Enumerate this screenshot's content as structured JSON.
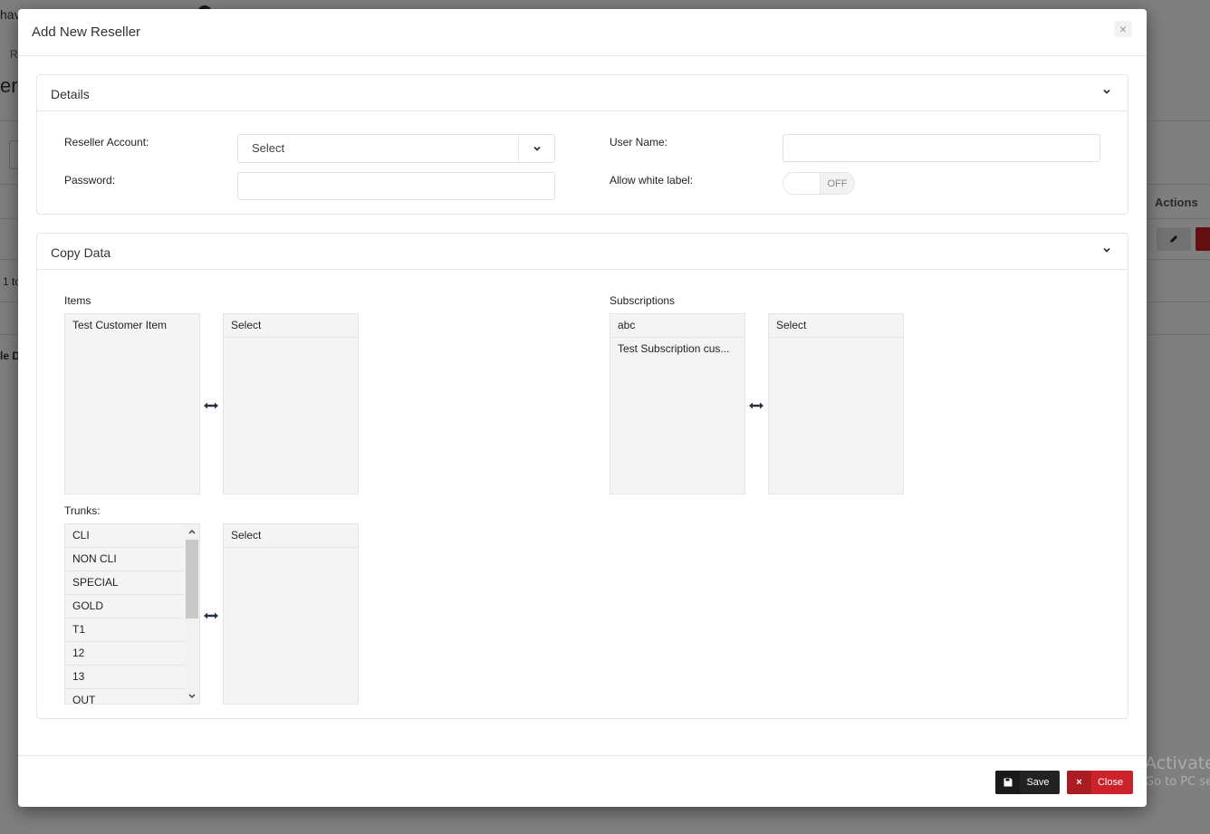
{
  "background_page": {
    "header_fragment": "hav",
    "breadcrumb_fragment": "R",
    "title_fragment": "ers",
    "paging_fragment": "1 to",
    "footer_fragment": "le D",
    "actions_header": "Actions"
  },
  "modal": {
    "title": "Add New Reseller",
    "close_icon": "×",
    "details": {
      "heading": "Details",
      "reseller_account_label": "Reseller Account:",
      "reseller_account_value": "Select",
      "password_label": "Password:",
      "password_value": "",
      "user_name_label": "User Name:",
      "user_name_value": "",
      "allow_white_label_label": "Allow white label:",
      "allow_white_label_state": "OFF"
    },
    "copy_data": {
      "heading": "Copy Data",
      "items": {
        "label": "Items",
        "available": [
          "Test Customer Item"
        ],
        "selected_header": "Select",
        "selected": []
      },
      "subscriptions": {
        "label": "Subscriptions",
        "available": [
          "abc",
          "Test Subscription cus..."
        ],
        "selected_header": "Select",
        "selected": []
      },
      "trunks": {
        "label": "Trunks:",
        "available": [
          "CLI",
          "NON CLI",
          "SPECIAL",
          "GOLD",
          "T1",
          "12",
          "13",
          "OUT"
        ],
        "selected_header": "Select",
        "selected": []
      }
    },
    "footer": {
      "save_label": "Save",
      "close_label": "Close",
      "close_icon": "×"
    }
  },
  "os_watermark": {
    "line1": "Activate",
    "line2": "Go to PC se"
  },
  "colors": {
    "save_button": "#222222",
    "close_button": "#cc2229",
    "list_background": "#f4f4f4"
  }
}
